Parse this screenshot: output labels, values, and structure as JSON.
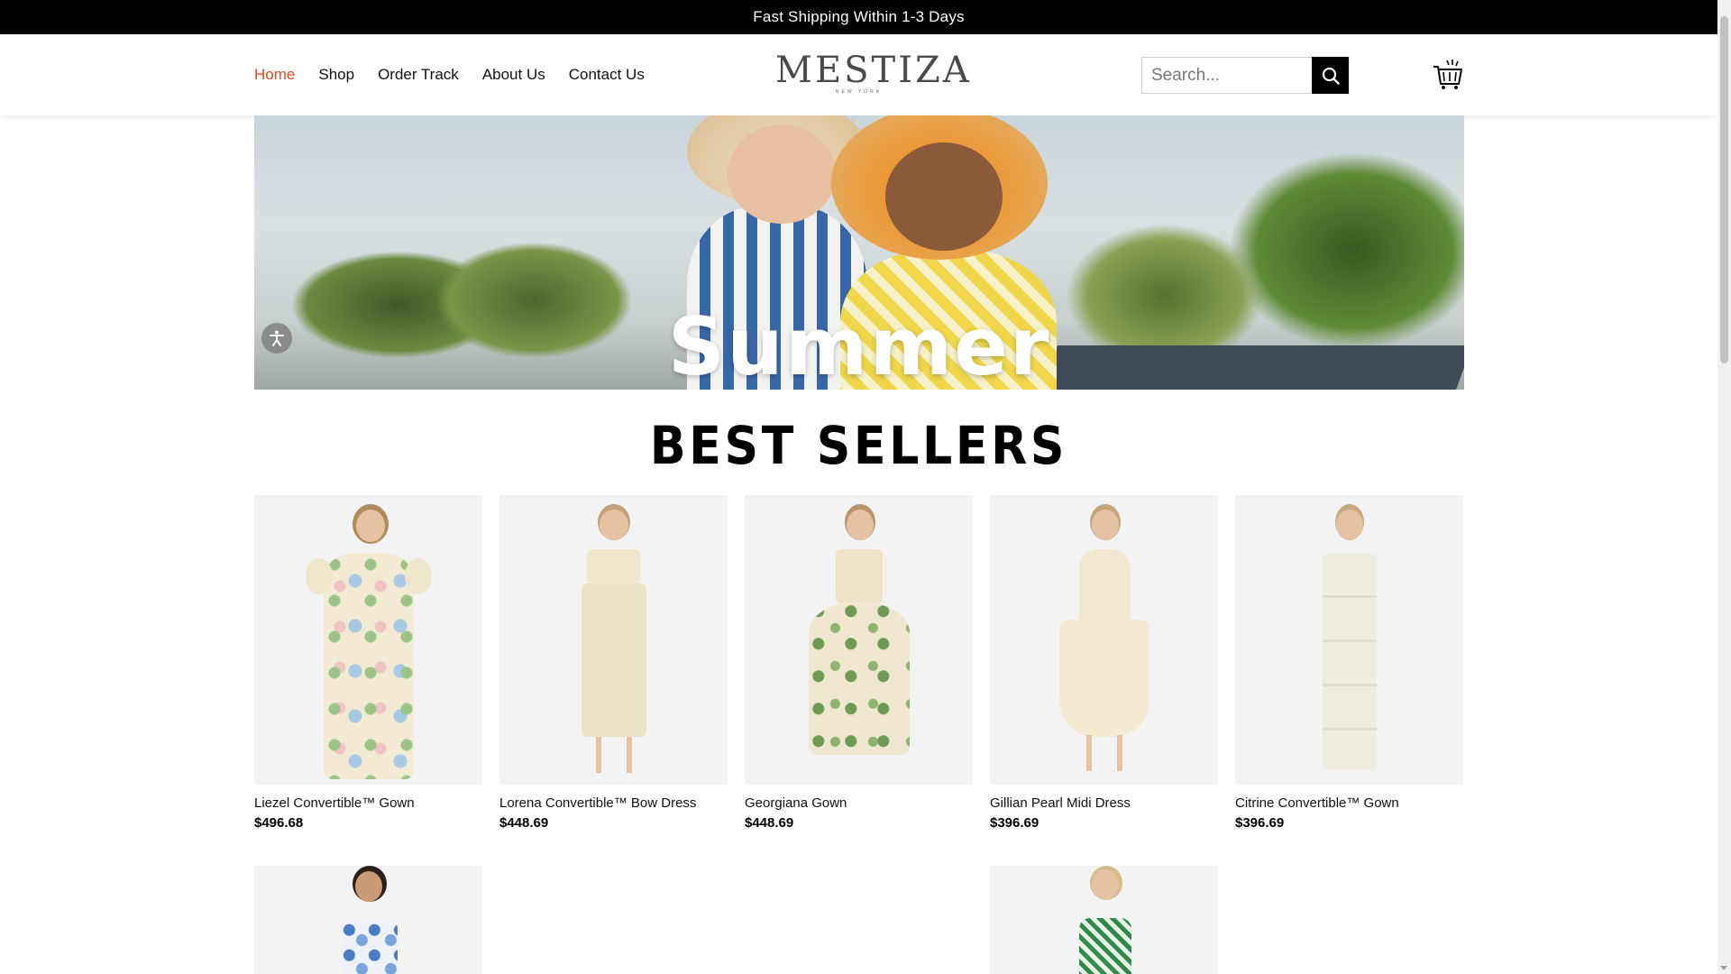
{
  "announcement": "Fast Shipping Within 1-3 Days",
  "nav": {
    "items": [
      {
        "label": "Home",
        "active": true
      },
      {
        "label": "Shop",
        "active": false
      },
      {
        "label": "Order Track",
        "active": false
      },
      {
        "label": "About Us",
        "active": false
      },
      {
        "label": "Contact Us",
        "active": false
      }
    ]
  },
  "brand": {
    "name": "MESTIZA",
    "tagline": "NEW YORK"
  },
  "search": {
    "placeholder": "Search..."
  },
  "hero": {
    "headline": "Summer"
  },
  "best_sellers": {
    "title": "BEST SELLERS",
    "products": [
      {
        "name": "Liezel Convertible™ Gown",
        "price": "$496.68"
      },
      {
        "name": "Lorena Convertible™ Bow Dress",
        "price": "$448.69"
      },
      {
        "name": "Georgiana Gown",
        "price": "$448.69"
      },
      {
        "name": "Gillian Pearl Midi Dress",
        "price": "$396.69"
      },
      {
        "name": "Citrine Convertible™ Gown",
        "price": "$396.69"
      }
    ]
  },
  "colors": {
    "accent": "#e24a1c",
    "topbar": "#000000",
    "text": "#111111"
  },
  "icons": {
    "search": "search-icon",
    "cart": "cart-icon",
    "accessibility": "accessibility-icon"
  }
}
